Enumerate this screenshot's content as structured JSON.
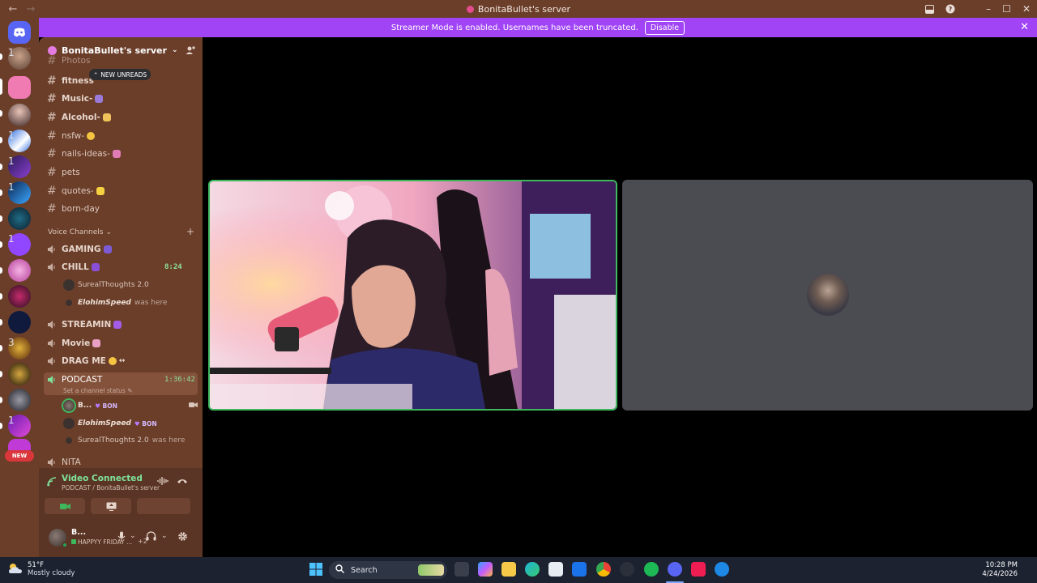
{
  "window": {
    "title": "BonitaBullet's server",
    "back_label": "←",
    "forward_label": "→",
    "min_label": "–",
    "max_label": "☐",
    "close_label": "✕"
  },
  "banner": {
    "text": "Streamer Mode is enabled. Usernames have been truncated.",
    "button": "Disable",
    "close": "✕"
  },
  "guilds": {
    "badges": [
      "1",
      "1",
      "1",
      "1",
      "1",
      "3",
      "1"
    ],
    "new_label": "NEW"
  },
  "server": {
    "name": "BonitaBullet's server",
    "new_unreads": "NEW UNREADS",
    "text_channels": [
      {
        "name": "Photos"
      },
      {
        "name": "fitness"
      },
      {
        "name": "Music-"
      },
      {
        "name": "Alcohol-"
      },
      {
        "name": "nsfw-"
      },
      {
        "name": "nails-ideas-"
      },
      {
        "name": "pets"
      },
      {
        "name": "quotes-"
      },
      {
        "name": "born-day"
      }
    ],
    "voice_header": "Voice Channels",
    "voice_channels": {
      "gaming": "GAMING",
      "chill": "CHILL",
      "chill_timer": "8:24",
      "chill_member_1": "SurealThoughts 2.0",
      "chill_member_2": "ElohimSpeed",
      "chill_member_2_suffix": "was here",
      "streamin": "STREAMIN",
      "movie": "Movie",
      "drag_me": "DRAG ME",
      "podcast": "PODCAST",
      "podcast_timer": "1:36:42",
      "podcast_status": "Set a channel status",
      "podcast_member_1": "B...",
      "podcast_member_1_tag": "BON",
      "podcast_member_2": "ElohimSpeed",
      "podcast_member_2_tag": "BON",
      "podcast_member_3": "SurealThoughts 2.0",
      "podcast_member_3_suffix": "was here",
      "nita": "NITA"
    }
  },
  "voice_panel": {
    "status": "Video Connected",
    "location": "PODCAST / BonitaBullet's server"
  },
  "user_panel": {
    "name": "B...",
    "status": "HAPPYY FRIDAY ...",
    "extra": "+2"
  },
  "taskbar": {
    "temperature": "51°F",
    "weather": "Mostly cloudy",
    "search_placeholder": "Search",
    "time": "10:28 PM",
    "date": "4/24/2026"
  },
  "colors": {
    "sidebar": "#6b3e2a",
    "banner": "#a044f5",
    "speaking_border": "#3fb85d",
    "connected_green": "#7fe29a"
  }
}
